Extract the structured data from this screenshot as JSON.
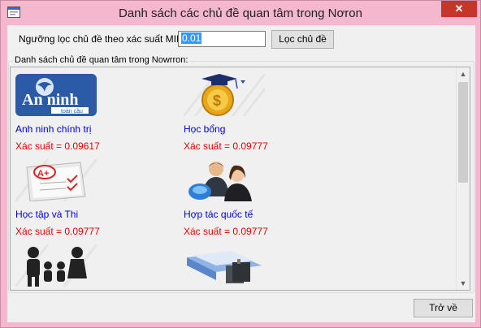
{
  "window": {
    "title": "Danh sách các chủ đề quan tâm trong Nơron",
    "close_glyph": "✕"
  },
  "filter": {
    "label": "Ngưỡng lọc chủ đề theo xác suất MIN:",
    "value": "0.01",
    "button_label": "Lọc chủ đề"
  },
  "group": {
    "caption": "Danh sách chủ đề quan tâm trong Nowrron:"
  },
  "topics": [
    {
      "name": "Anh ninh chính trị",
      "probability": "Xác suất = 0.09617",
      "icon": "security-news-logo-icon",
      "logo_text": "An ninh",
      "logo_sub": "toàn cầu"
    },
    {
      "name": "Học bổng",
      "probability": "Xác suất = 0.09777",
      "icon": "scholarship-coin-icon"
    },
    {
      "name": "Học tập và Thi",
      "probability": "Xác suất = 0.09777",
      "icon": "exam-paper-icon",
      "grade": "A+"
    },
    {
      "name": "Hợp tác quốc tế",
      "probability": "Xác suất = 0.09777",
      "icon": "business-people-globe-icon"
    },
    {
      "name": "",
      "probability": "",
      "icon": "family-icon"
    },
    {
      "name": "",
      "probability": "",
      "icon": "folders-icon"
    }
  ],
  "scroll": {
    "up": "▲",
    "down": "▼"
  },
  "footer": {
    "back_label": "Trở về"
  },
  "colors": {
    "titlebar": "#f4b7cd",
    "close": "#c7342a",
    "topic_name": "#0000cd",
    "probability": "#e00000",
    "client": "#f0f0f0"
  }
}
